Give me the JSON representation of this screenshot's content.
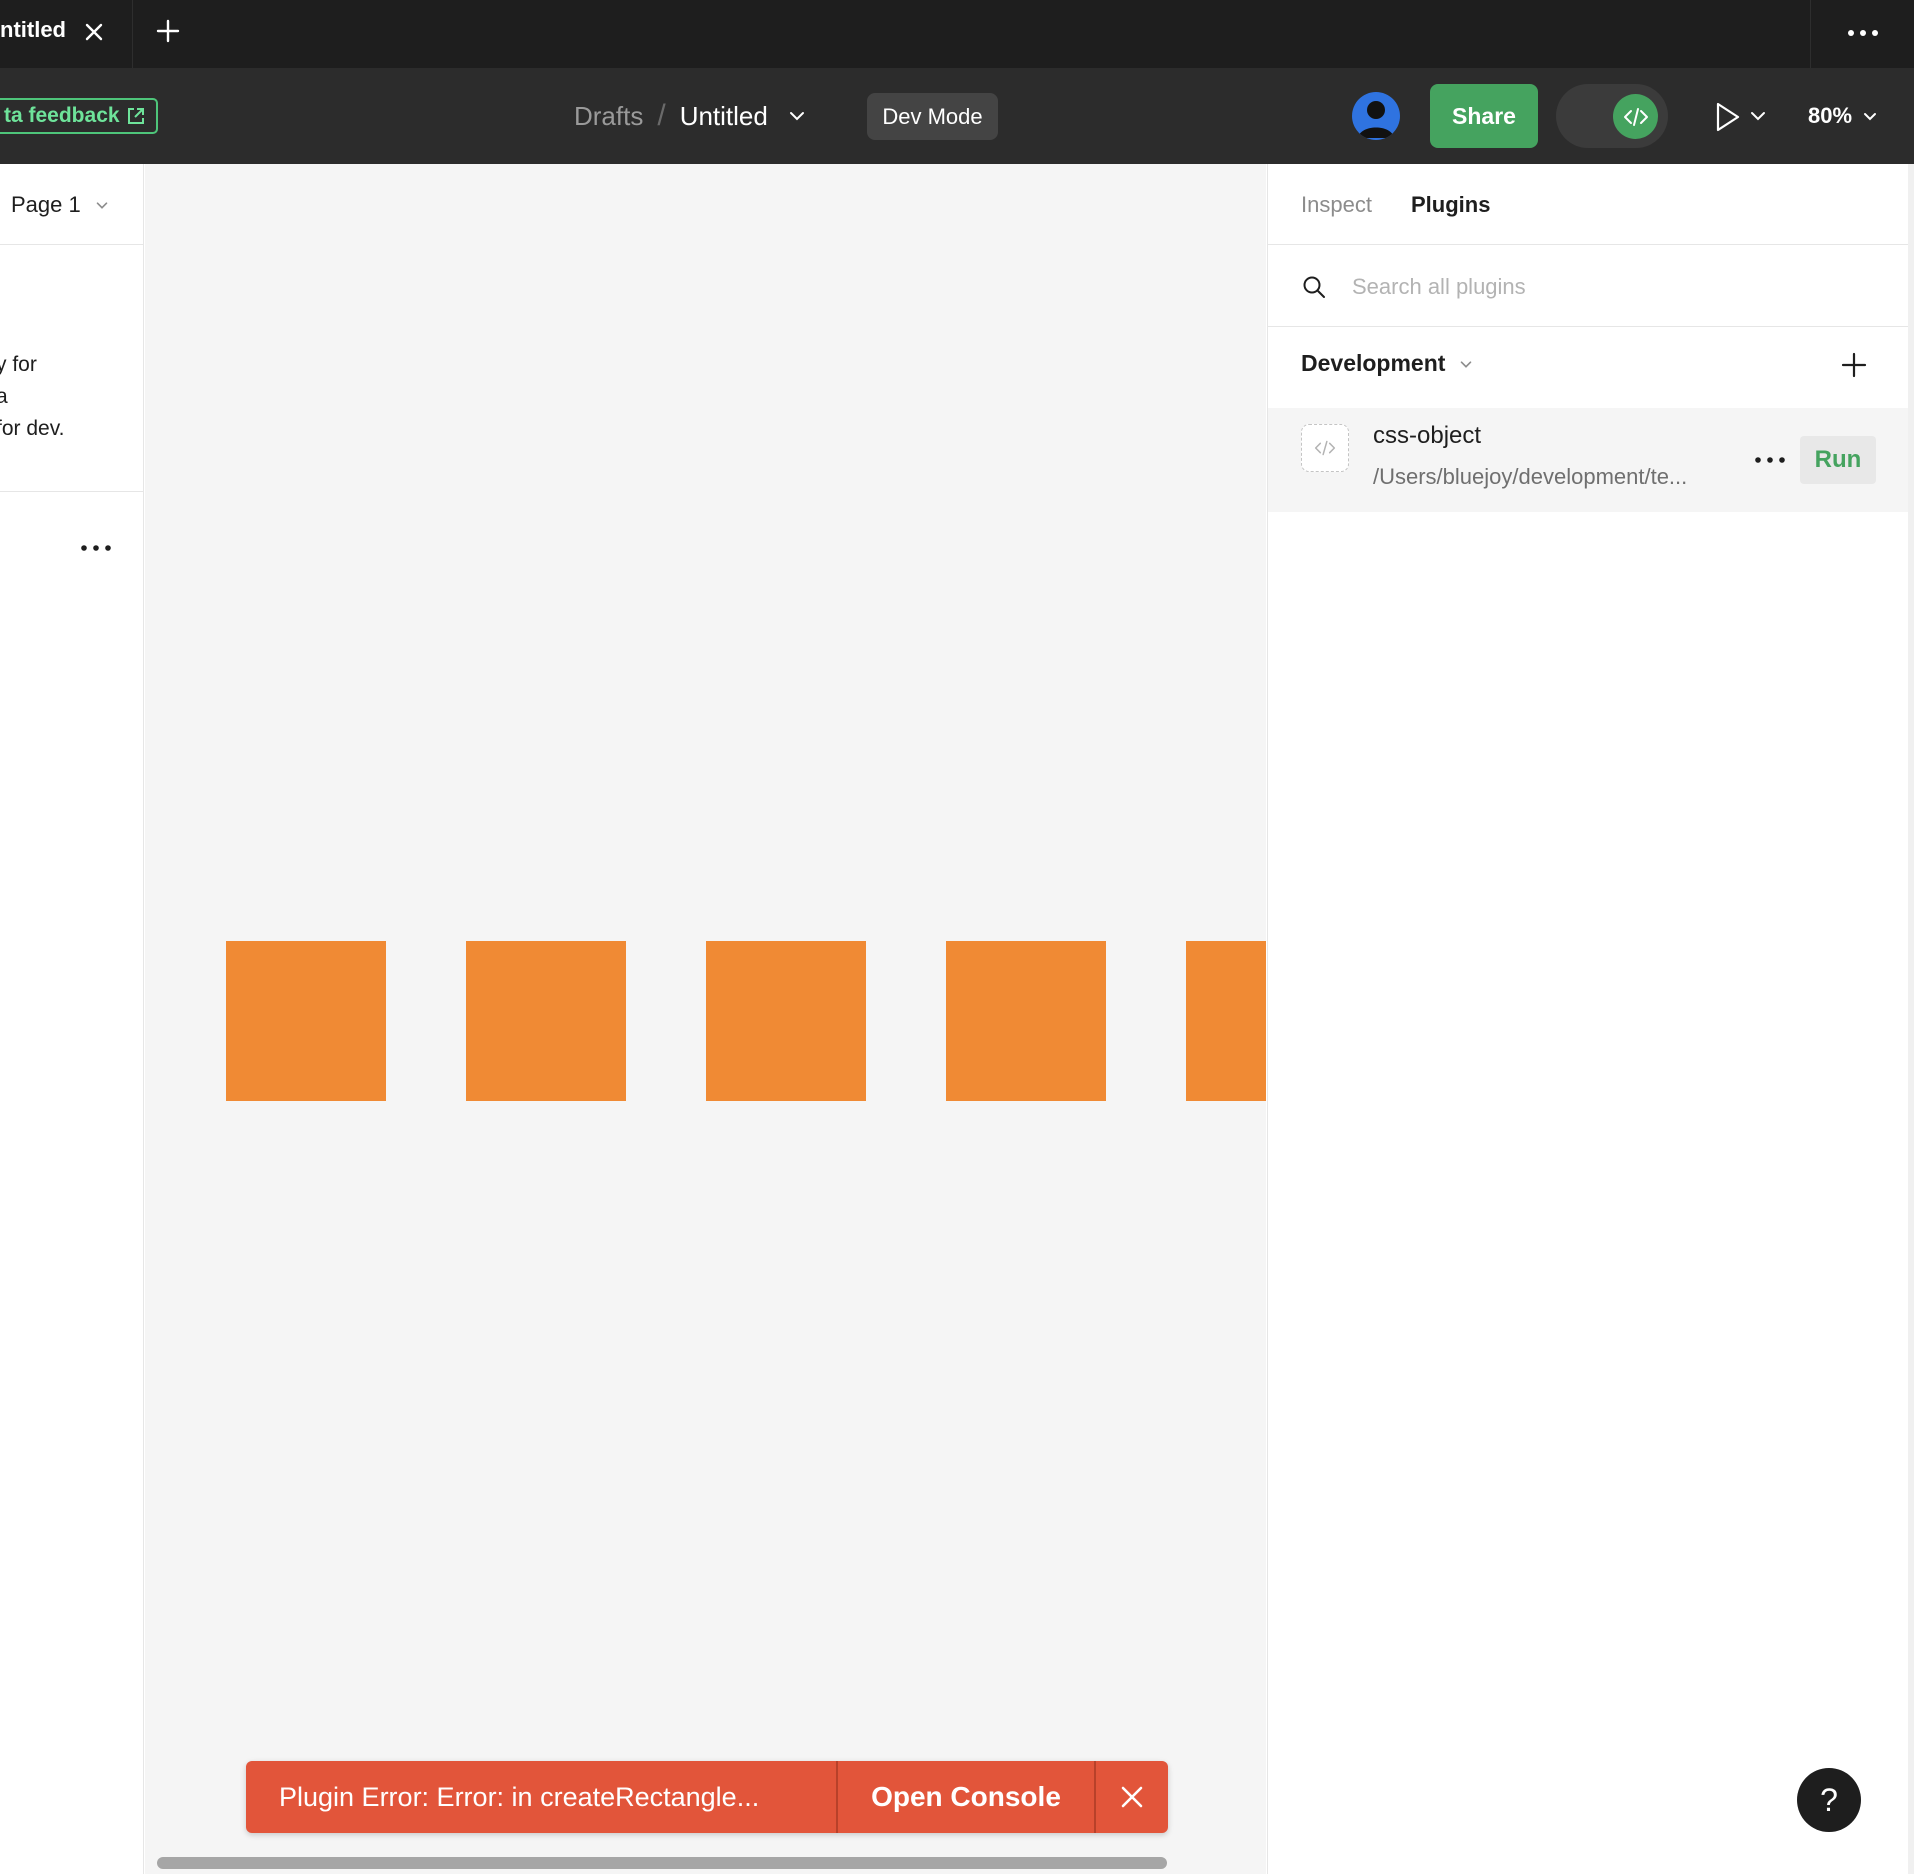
{
  "tabbar": {
    "active_tab_title": "ntitled"
  },
  "toolbar": {
    "beta_feedback_label": "ta feedback",
    "breadcrumb_root": "Drafts",
    "breadcrumb_separator": "/",
    "file_title": "Untitled",
    "dev_mode_badge": "Dev Mode",
    "share_label": "Share",
    "zoom_level": "80%"
  },
  "left_panel": {
    "page_name": "Page 1",
    "notice_lines": [
      "y for",
      " a",
      "for dev."
    ]
  },
  "canvas": {
    "rectangle_color": "#f08a34",
    "rectangle_count_visible": 5
  },
  "toast": {
    "message": "Plugin Error: Error: in createRectangle...",
    "action_label": "Open Console",
    "color": "#e2553a"
  },
  "right_panel": {
    "tabs": [
      {
        "label": "Inspect",
        "active": false
      },
      {
        "label": "Plugins",
        "active": true
      }
    ],
    "search_placeholder": "Search all plugins",
    "section_title": "Development",
    "plugins": [
      {
        "name": "css-object",
        "path": "/Users/bluejoy/development/te...",
        "run_label": "Run"
      }
    ],
    "help_label": "?"
  },
  "colors": {
    "accent_green": "#45a35f",
    "toolbar_bg": "#2c2c2c",
    "tabbar_bg": "#1e1e1e",
    "avatar_blue": "#2f73e0"
  }
}
